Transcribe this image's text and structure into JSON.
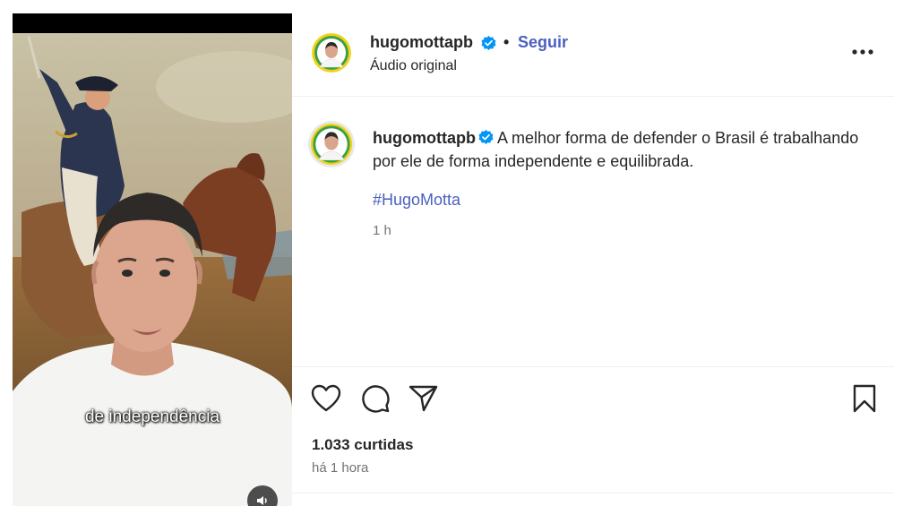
{
  "video": {
    "caption": "de independência"
  },
  "post": {
    "username": "hugomottapb",
    "dot": "•",
    "follow_label": "Seguir",
    "audio_label": "Áudio original"
  },
  "comment": {
    "username": "hugomottapb",
    "text": "A melhor forma de defender o Brasil é trabalhando por ele de forma independente e equilibrada.",
    "hashtag": "#HugoMotta",
    "time": "1 h"
  },
  "stats": {
    "likes": "1.033 curtidas",
    "time_ago": "há 1 hora"
  },
  "colors": {
    "link": "#4a5fc1",
    "verified": "#0095f6",
    "text": "#262626",
    "muted": "#737373"
  },
  "icons": [
    "more-options-icon",
    "verified-icon",
    "heart-icon",
    "comment-icon",
    "share-icon",
    "bookmark-icon",
    "speaker-icon"
  ]
}
